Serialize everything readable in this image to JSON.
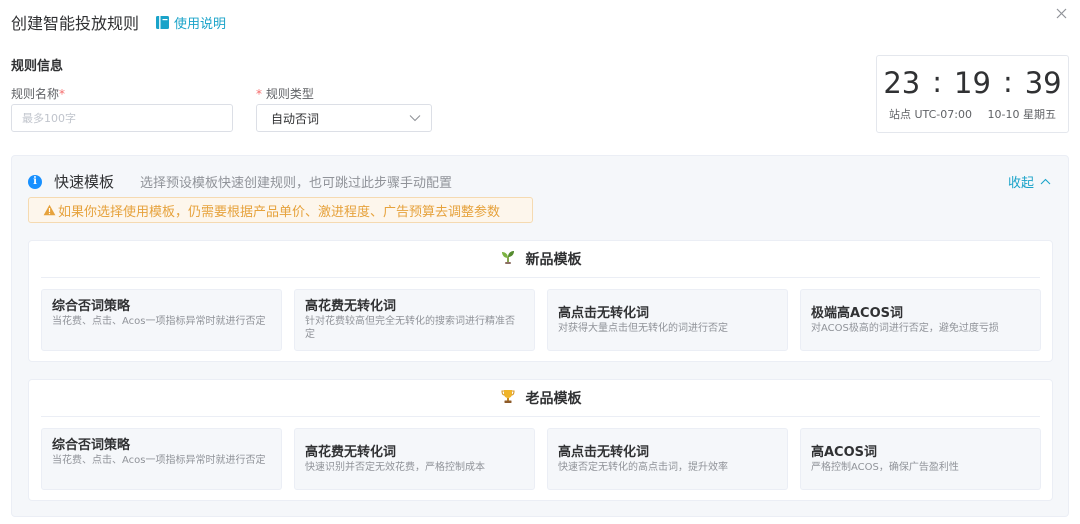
{
  "header": {
    "title": "创建智能投放规则",
    "help_label": "使用说明"
  },
  "rule_info": {
    "section_title": "规则信息",
    "name_label": "规则名称",
    "name_placeholder": "最多100字",
    "type_label": "规则类型",
    "type_value": "自动否词"
  },
  "clock": {
    "hours": "23",
    "minutes": "19",
    "seconds": "39",
    "separator": ":",
    "timezone": "站点 UTC-07:00",
    "date": "10-10 星期五"
  },
  "quick": {
    "title": "快速模板",
    "description": "选择预设模板快速创建规则，也可跳过此步骤手动配置",
    "collapse_label": "收起",
    "warning": "如果你选择使用模板，仍需要根据产品单价、激进程度、广告预算去调整参数"
  },
  "groups": [
    {
      "title": "新品模板",
      "icon": "sprout-icon",
      "cards": [
        {
          "title": "综合否词策略",
          "desc": "当花费、点击、Acos一项指标异常时就进行否定"
        },
        {
          "title": "高花费无转化词",
          "desc": "针对花费较高但完全无转化的搜索词进行精准否定"
        },
        {
          "title": "高点击无转化词",
          "desc": "对获得大量点击但无转化的词进行否定"
        },
        {
          "title": "极端高ACOS词",
          "desc": "对ACOS极高的词进行否定，避免过度亏损"
        }
      ]
    },
    {
      "title": "老品模板",
      "icon": "trophy-icon",
      "cards": [
        {
          "title": "综合否词策略",
          "desc": "当花费、点击、Acos一项指标异常时就进行否定"
        },
        {
          "title": "高花费无转化词",
          "desc": "快速识别并否定无效花费，严格控制成本"
        },
        {
          "title": "高点击无转化词",
          "desc": "快速否定无转化的高点击词，提升效率"
        },
        {
          "title": "高ACOS词",
          "desc": "严格控制ACOS，确保广告盈利性"
        }
      ]
    }
  ],
  "colors": {
    "accent": "#1aa3c9",
    "info": "#1890ff",
    "warning": "#e6a23c",
    "required": "#f56c6c"
  }
}
